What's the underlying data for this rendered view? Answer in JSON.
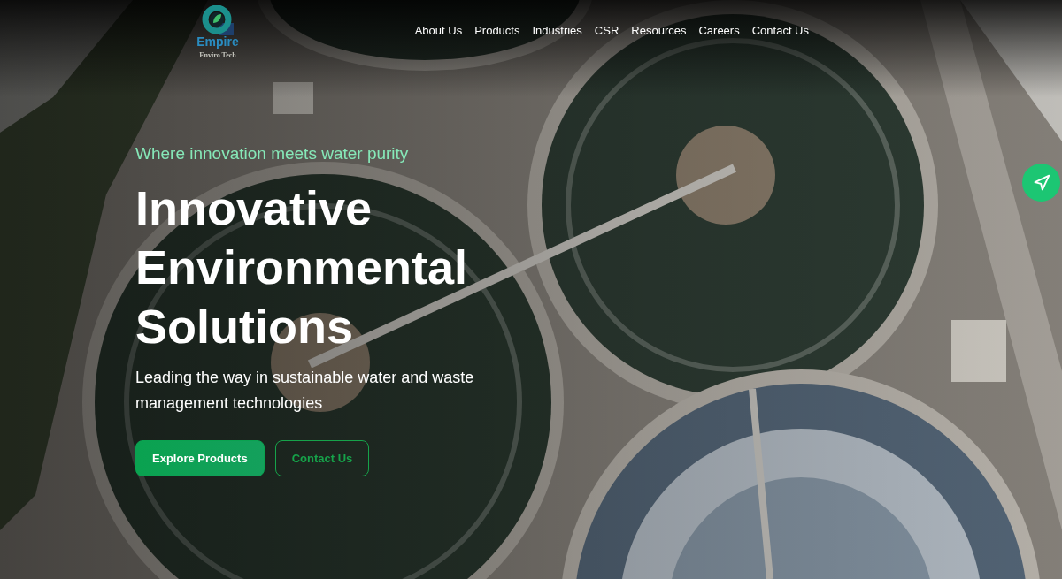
{
  "logo": {
    "name": "Empire",
    "tagline": "Enviro Tech"
  },
  "nav": {
    "items": [
      "About Us",
      "Products",
      "Industries",
      "CSR",
      "Resources",
      "Careers",
      "Contact Us"
    ]
  },
  "hero": {
    "eyebrow": "Where innovation meets water purity",
    "title": "Innovative Environmental Solutions",
    "subtitle": "Leading the way in sustainable water and waste management technologies",
    "buttons": [
      {
        "label": "Explore Products",
        "kind": "primary"
      },
      {
        "label": "Contact Us",
        "kind": "outline"
      }
    ]
  }
}
